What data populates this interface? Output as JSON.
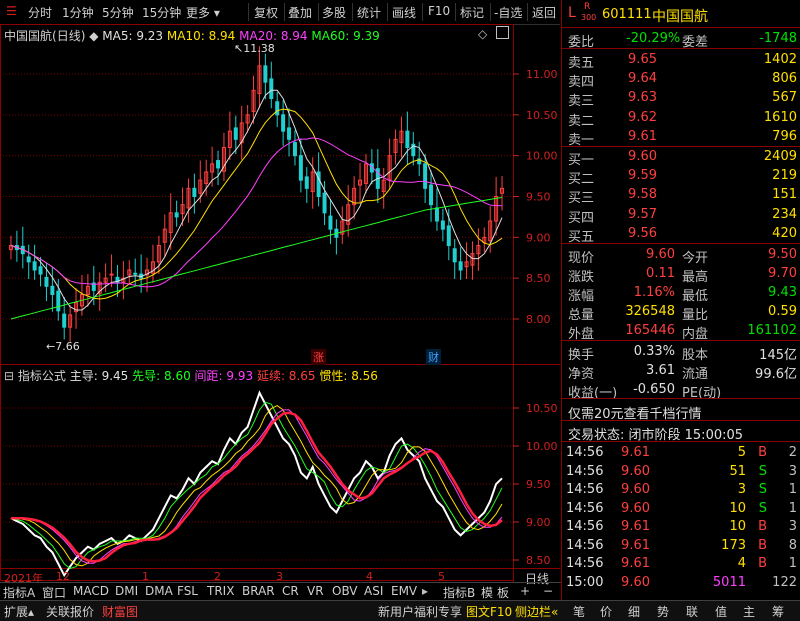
{
  "toolbar": {
    "items": [
      "分时",
      "1分钟",
      "5分钟",
      "15分钟",
      "更多",
      "复权",
      "叠加",
      "多股",
      "统计",
      "画线",
      "F10",
      "标记",
      "-自选",
      "返回"
    ]
  },
  "main_chart": {
    "title": "中国国航",
    "title_period": "(日线)",
    "ma": [
      {
        "label": "MA5: 9.23",
        "color": "#e0e0e0"
      },
      {
        "label": "MA10: 8.94",
        "color": "#ffe000"
      },
      {
        "label": "MA20: 8.94",
        "color": "#ff40ff"
      },
      {
        "label": "MA60: 9.39",
        "color": "#20ff20"
      }
    ],
    "high_mark": "11.38",
    "low_mark": "7.66",
    "y_ticks": [
      "11.00",
      "10.50",
      "10.00",
      "9.50",
      "9.00",
      "8.50",
      "8.00"
    ],
    "badge_rise": "涨",
    "badge_fin": "财"
  },
  "indicator": {
    "name": "指标公式",
    "items": [
      {
        "label": "主导: 9.45",
        "color": "#e0e0e0"
      },
      {
        "label": "先导: 8.60",
        "color": "#20ff20"
      },
      {
        "label": "间距: 9.93",
        "color": "#ff40ff"
      },
      {
        "label": "延续: 8.65",
        "color": "#ff4040"
      },
      {
        "label": "惯性: 8.56",
        "color": "#ffe000"
      }
    ],
    "y_ticks": [
      "10.50",
      "10.00",
      "9.50",
      "9.00",
      "8.50"
    ]
  },
  "x_axis": [
    "2021年",
    "12",
    "1",
    "2",
    "3",
    "4",
    "5"
  ],
  "x_axis_right": "日线",
  "indicator_tabs": [
    "指标A",
    "窗口",
    "MACD",
    "DMI",
    "DMA",
    "FSL",
    "TRIX",
    "BRAR",
    "CR",
    "VR",
    "OBV",
    "ASI",
    "EMV"
  ],
  "indicator_tabs_right": [
    "指标B",
    "模",
    "板",
    "+",
    "−"
  ],
  "bottom_tabs": [
    "扩展",
    "关联报价",
    "财富图"
  ],
  "bottom_links": [
    "新用户福利专享",
    "图文F10",
    "侧边栏"
  ],
  "bottom_right_tabs": [
    "笔",
    "价",
    "细",
    "势",
    "联",
    "值",
    "主",
    "筹"
  ],
  "stock": {
    "flag_l": "L",
    "flag_r": "R",
    "flag_num": "300",
    "code": "601111",
    "name": "中国国航"
  },
  "order_book": {
    "weibi_label": "委比",
    "weibi": "-20.29%",
    "weicha_label": "委差",
    "weicha": "-1748",
    "asks": [
      {
        "label": "卖五",
        "price": "9.65",
        "vol": "1402"
      },
      {
        "label": "卖四",
        "price": "9.64",
        "vol": "806"
      },
      {
        "label": "卖三",
        "price": "9.63",
        "vol": "567"
      },
      {
        "label": "卖二",
        "price": "9.62",
        "vol": "1610"
      },
      {
        "label": "卖一",
        "price": "9.61",
        "vol": "796"
      }
    ],
    "bids": [
      {
        "label": "买一",
        "price": "9.60",
        "vol": "2409"
      },
      {
        "label": "买二",
        "price": "9.59",
        "vol": "219"
      },
      {
        "label": "买三",
        "price": "9.58",
        "vol": "151"
      },
      {
        "label": "买四",
        "price": "9.57",
        "vol": "234"
      },
      {
        "label": "买五",
        "price": "9.56",
        "vol": "420"
      }
    ]
  },
  "quote": [
    {
      "l1": "现价",
      "v1": "9.60",
      "c1": "red",
      "l2": "今开",
      "v2": "9.50",
      "c2": "red"
    },
    {
      "l1": "涨跌",
      "v1": "0.11",
      "c1": "red",
      "l2": "最高",
      "v2": "9.70",
      "c2": "red"
    },
    {
      "l1": "涨幅",
      "v1": "1.16%",
      "c1": "red",
      "l2": "最低",
      "v2": "9.43",
      "c2": "green"
    },
    {
      "l1": "总量",
      "v1": "326548",
      "c1": "yellow",
      "l2": "量比",
      "v2": "0.59",
      "c2": "yellow"
    },
    {
      "l1": "外盘",
      "v1": "165446",
      "c1": "red",
      "l2": "内盘",
      "v2": "161102",
      "c2": "green"
    }
  ],
  "quote2": [
    {
      "l1": "换手",
      "v1": "0.33%",
      "l2": "股本",
      "v2": "145亿"
    },
    {
      "l1": "净资",
      "v1": "3.61",
      "l2": "流通",
      "v2": "99.6亿"
    },
    {
      "l1": "收益(一)",
      "v1": "-0.650",
      "l2": "PE(动)",
      "v2": ""
    }
  ],
  "promo": "仅需20元查看千档行情",
  "trade_status": "交易状态: 闭市阶段 15:00:05",
  "ticks": [
    {
      "time": "14:56",
      "price": "9.61",
      "vol": "5",
      "dir": "B",
      "cnt": "2"
    },
    {
      "time": "14:56",
      "price": "9.60",
      "vol": "51",
      "dir": "S",
      "cnt": "3"
    },
    {
      "time": "14:56",
      "price": "9.60",
      "vol": "3",
      "dir": "S",
      "cnt": "1"
    },
    {
      "time": "14:56",
      "price": "9.60",
      "vol": "10",
      "dir": "S",
      "cnt": "1"
    },
    {
      "time": "14:56",
      "price": "9.61",
      "vol": "10",
      "dir": "B",
      "cnt": "3"
    },
    {
      "time": "14:56",
      "price": "9.61",
      "vol": "173",
      "dir": "B",
      "cnt": "8"
    },
    {
      "time": "14:56",
      "price": "9.61",
      "vol": "4",
      "dir": "B",
      "cnt": "1"
    },
    {
      "time": "15:00",
      "price": "9.60",
      "vol": "5011",
      "dir": "",
      "cnt": "122"
    }
  ]
}
